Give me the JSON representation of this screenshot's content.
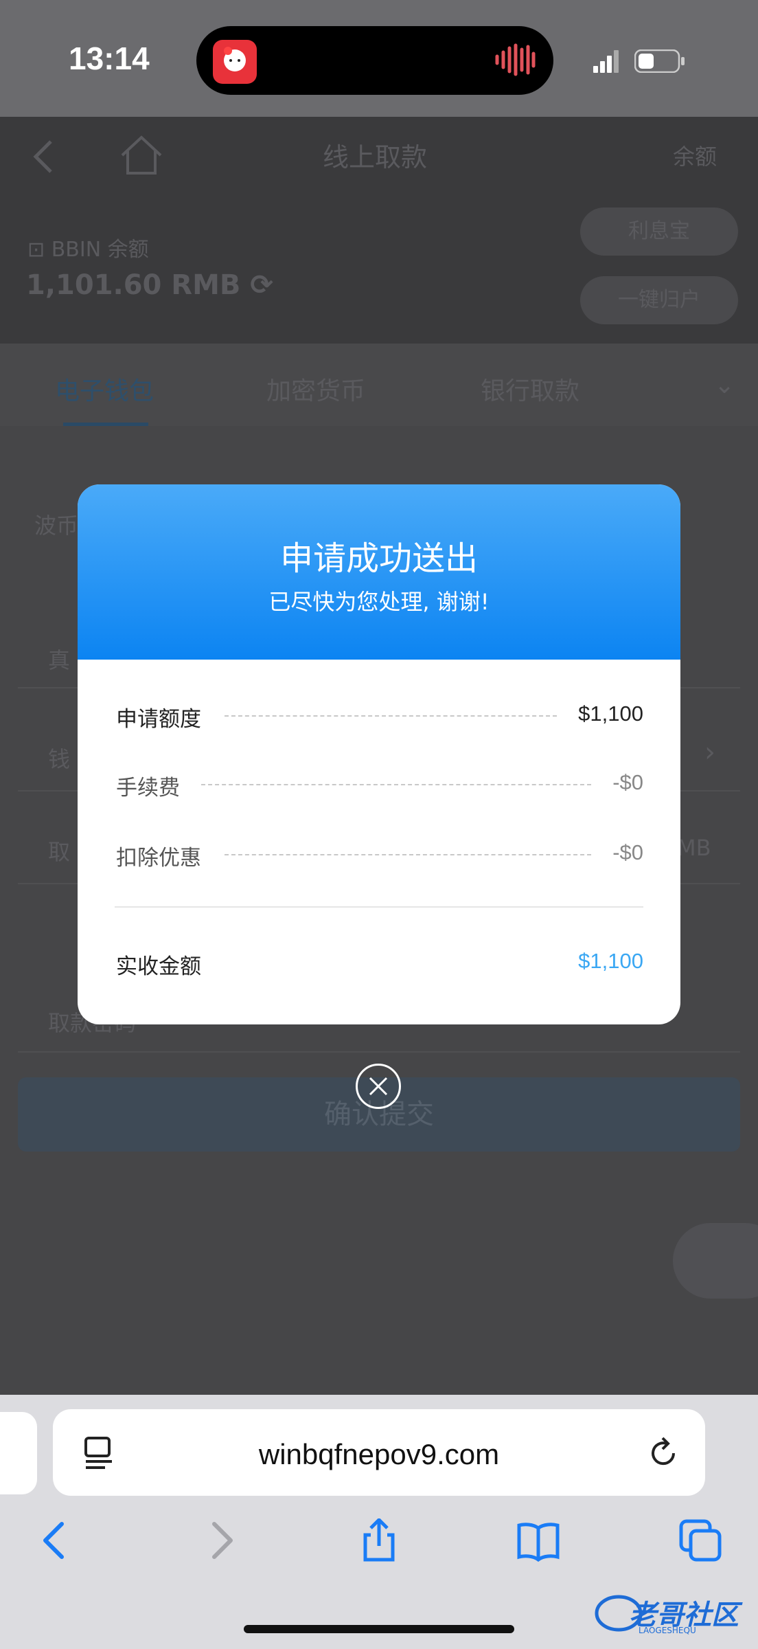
{
  "status_bar": {
    "time": "13:14"
  },
  "app": {
    "title": "线上取款",
    "balance_link": "余额",
    "bbin_label": "BBIN 余额",
    "bbin_amount": "1,101.60 RMB",
    "interest_button": "利息宝",
    "collect_button": "一键归户",
    "tabs": [
      "电子钱包",
      "加密货币",
      "银行取款"
    ],
    "partial_labels": [
      "波币",
      "真",
      "钱",
      "取",
      "MB",
      "取款密码"
    ],
    "submit_button": "确认提交"
  },
  "modal": {
    "title": "申请成功送出",
    "subtitle": "已尽快为您处理, 谢谢!",
    "rows": [
      {
        "label": "申请额度",
        "value": "$1,100"
      },
      {
        "label": "手续费",
        "value": "-$0"
      },
      {
        "label": "扣除优惠",
        "value": "-$0"
      }
    ],
    "total": {
      "label": "实收金额",
      "value": "$1,100"
    }
  },
  "browser": {
    "url": "winbqfnepov9.com"
  },
  "watermark": {
    "text": "老哥社区",
    "sub": "LAOGESHEQU"
  },
  "colors": {
    "accent": "#0c84f2",
    "total_value": "#3aa7f3"
  }
}
